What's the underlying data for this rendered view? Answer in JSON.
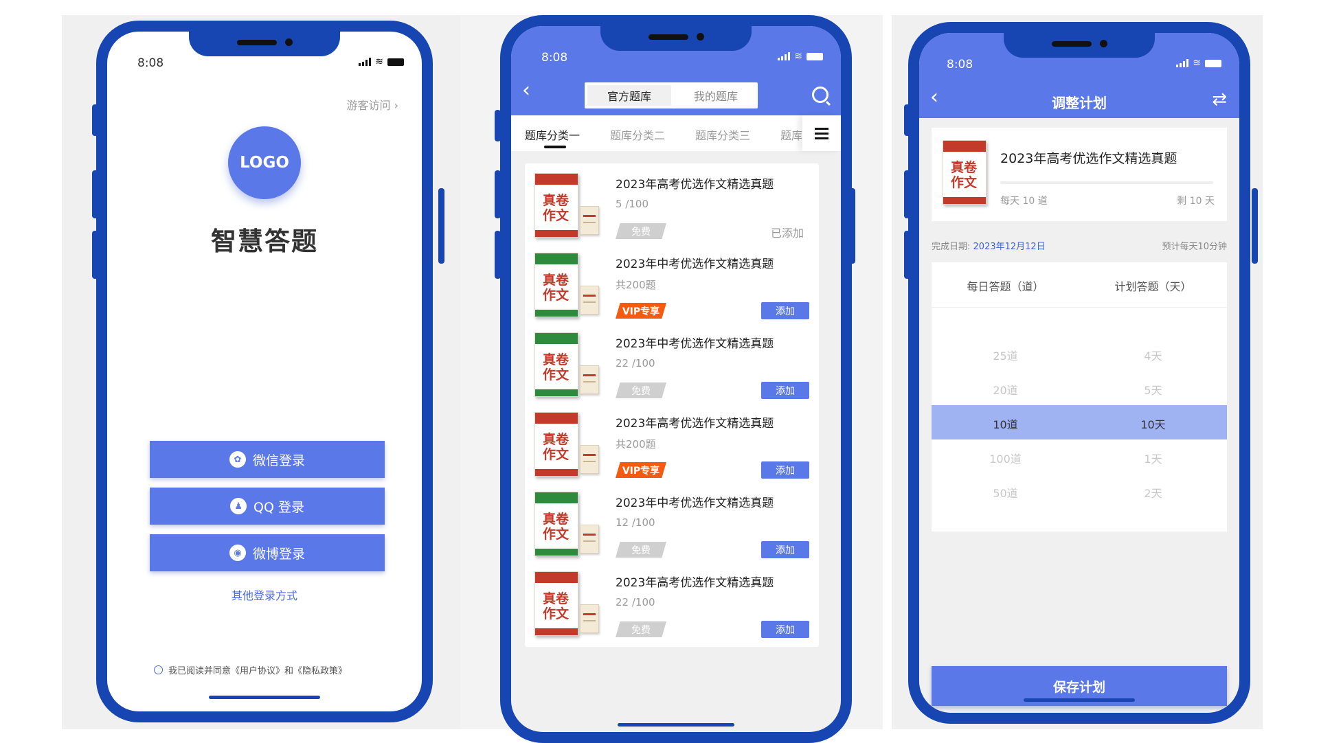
{
  "status_time": "8:08",
  "colors": {
    "frame": "#1746b2",
    "primary": "#5a78e8",
    "vip": "#f35b10",
    "book_red": "#c43a2a",
    "book_green": "#2e8b3e"
  },
  "login": {
    "guest_link": "游客访问 ›",
    "logo_text": "LOGO",
    "app_name": "智慧答题",
    "buttons": [
      {
        "label": "微信登录",
        "icon": "wechat-icon",
        "glyph": "✿"
      },
      {
        "label": "QQ 登录",
        "icon": "qq-icon",
        "glyph": "♟"
      },
      {
        "label": "微博登录",
        "icon": "weibo-icon",
        "glyph": "◉"
      }
    ],
    "other_login": "其他登录方式",
    "agreement": "我已阅读并同意《用户协议》和《隐私政策》"
  },
  "bank": {
    "back_icon": "back-icon",
    "tabs": {
      "official": "官方题库",
      "mine": "我的题库"
    },
    "categories": [
      "题库分类一",
      "题库分类二",
      "题库分类三",
      "题库"
    ],
    "cards": [
      {
        "title": "2023年高考优选作文精选真题",
        "count": "5 /100",
        "tag": "免费",
        "tag_type": "free",
        "action": "已添加",
        "action_type": "added",
        "cover": "red"
      },
      {
        "title": "2023年中考优选作文精选真题",
        "count": "共200题",
        "tag": "VIP专享",
        "tag_type": "vip",
        "action": "添加",
        "action_type": "add",
        "cover": "green"
      },
      {
        "title": "2023年中考优选作文精选真题",
        "count": "22 /100",
        "tag": "免费",
        "tag_type": "free",
        "action": "添加",
        "action_type": "add",
        "cover": "green"
      },
      {
        "title": "2023年高考优选作文精选真题",
        "count": "共200题",
        "tag": "VIP专享",
        "tag_type": "vip",
        "action": "添加",
        "action_type": "add",
        "cover": "red"
      },
      {
        "title": "2023年中考优选作文精选真题",
        "count": "12 /100",
        "tag": "免费",
        "tag_type": "free",
        "action": "添加",
        "action_type": "add",
        "cover": "green"
      },
      {
        "title": "2023年高考优选作文精选真题",
        "count": "22 /100",
        "tag": "免费",
        "tag_type": "free",
        "action": "添加",
        "action_type": "add",
        "cover": "red"
      }
    ],
    "cover_chars": "真卷作文"
  },
  "plan": {
    "title": "调整计划",
    "swap_icon": "⇄",
    "book_title": "2023年高考优选作文精选真题",
    "daily": "每天 10 道",
    "remaining": "剩 10 天",
    "finish_label": "完成日期:",
    "finish_date": "2023年12月12日",
    "estimate": "预计每天10分钟",
    "col_daily": "每日答题（道）",
    "col_days": "计划答题（天）",
    "rows": [
      {
        "a": "25道",
        "b": "4天",
        "selected": false
      },
      {
        "a": "20道",
        "b": "5天",
        "selected": false
      },
      {
        "a": "10道",
        "b": "10天",
        "selected": true
      },
      {
        "a": "100道",
        "b": "1天",
        "selected": false
      },
      {
        "a": "50道",
        "b": "2天",
        "selected": false
      }
    ],
    "save": "保存计划"
  }
}
